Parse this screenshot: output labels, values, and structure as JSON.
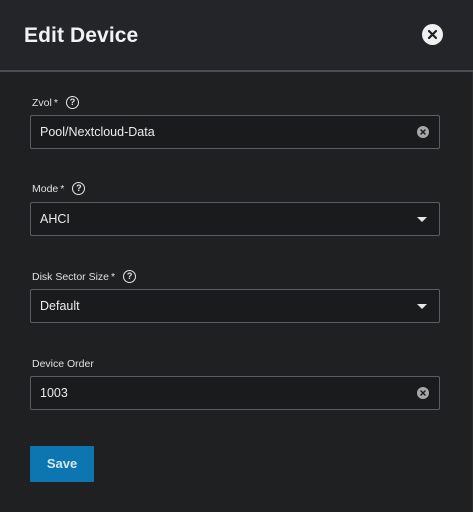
{
  "dialog": {
    "title": "Edit Device",
    "close_icon": "close-icon"
  },
  "fields": {
    "zvol": {
      "label": "Zvol",
      "required_mark": "*",
      "help_icon": "?",
      "value": "Pool/Nextcloud-Data"
    },
    "mode": {
      "label": "Mode",
      "required_mark": "*",
      "help_icon": "?",
      "value": "AHCI"
    },
    "disk_sector_size": {
      "label": "Disk Sector Size",
      "required_mark": "*",
      "help_icon": "?",
      "value": "Default"
    },
    "device_order": {
      "label": "Device Order",
      "value": "1003"
    }
  },
  "actions": {
    "save_label": "Save"
  },
  "colors": {
    "background": "#1e2022",
    "header": "#232528",
    "accent": "#0d76b0",
    "input_border": "#5a5d61"
  }
}
